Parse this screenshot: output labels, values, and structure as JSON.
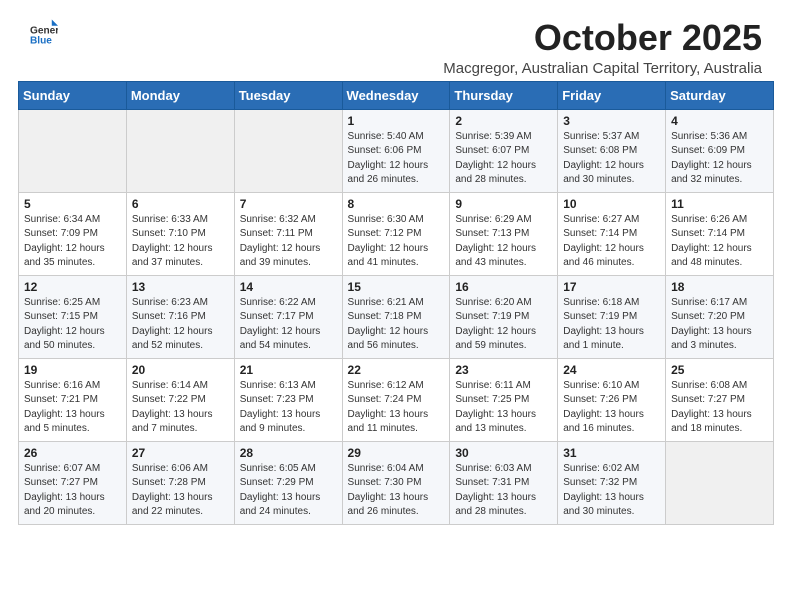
{
  "logo": {
    "text_general": "General",
    "text_blue": "Blue",
    "icon_label": "general-blue-logo"
  },
  "title": "October 2025",
  "subtitle": "Macgregor, Australian Capital Territory, Australia",
  "weekdays": [
    "Sunday",
    "Monday",
    "Tuesday",
    "Wednesday",
    "Thursday",
    "Friday",
    "Saturday"
  ],
  "weeks": [
    [
      {
        "day": "",
        "info": ""
      },
      {
        "day": "",
        "info": ""
      },
      {
        "day": "",
        "info": ""
      },
      {
        "day": "1",
        "info": "Sunrise: 5:40 AM\nSunset: 6:06 PM\nDaylight: 12 hours\nand 26 minutes."
      },
      {
        "day": "2",
        "info": "Sunrise: 5:39 AM\nSunset: 6:07 PM\nDaylight: 12 hours\nand 28 minutes."
      },
      {
        "day": "3",
        "info": "Sunrise: 5:37 AM\nSunset: 6:08 PM\nDaylight: 12 hours\nand 30 minutes."
      },
      {
        "day": "4",
        "info": "Sunrise: 5:36 AM\nSunset: 6:09 PM\nDaylight: 12 hours\nand 32 minutes."
      }
    ],
    [
      {
        "day": "5",
        "info": "Sunrise: 6:34 AM\nSunset: 7:09 PM\nDaylight: 12 hours\nand 35 minutes."
      },
      {
        "day": "6",
        "info": "Sunrise: 6:33 AM\nSunset: 7:10 PM\nDaylight: 12 hours\nand 37 minutes."
      },
      {
        "day": "7",
        "info": "Sunrise: 6:32 AM\nSunset: 7:11 PM\nDaylight: 12 hours\nand 39 minutes."
      },
      {
        "day": "8",
        "info": "Sunrise: 6:30 AM\nSunset: 7:12 PM\nDaylight: 12 hours\nand 41 minutes."
      },
      {
        "day": "9",
        "info": "Sunrise: 6:29 AM\nSunset: 7:13 PM\nDaylight: 12 hours\nand 43 minutes."
      },
      {
        "day": "10",
        "info": "Sunrise: 6:27 AM\nSunset: 7:14 PM\nDaylight: 12 hours\nand 46 minutes."
      },
      {
        "day": "11",
        "info": "Sunrise: 6:26 AM\nSunset: 7:14 PM\nDaylight: 12 hours\nand 48 minutes."
      }
    ],
    [
      {
        "day": "12",
        "info": "Sunrise: 6:25 AM\nSunset: 7:15 PM\nDaylight: 12 hours\nand 50 minutes."
      },
      {
        "day": "13",
        "info": "Sunrise: 6:23 AM\nSunset: 7:16 PM\nDaylight: 12 hours\nand 52 minutes."
      },
      {
        "day": "14",
        "info": "Sunrise: 6:22 AM\nSunset: 7:17 PM\nDaylight: 12 hours\nand 54 minutes."
      },
      {
        "day": "15",
        "info": "Sunrise: 6:21 AM\nSunset: 7:18 PM\nDaylight: 12 hours\nand 56 minutes."
      },
      {
        "day": "16",
        "info": "Sunrise: 6:20 AM\nSunset: 7:19 PM\nDaylight: 12 hours\nand 59 minutes."
      },
      {
        "day": "17",
        "info": "Sunrise: 6:18 AM\nSunset: 7:19 PM\nDaylight: 13 hours\nand 1 minute."
      },
      {
        "day": "18",
        "info": "Sunrise: 6:17 AM\nSunset: 7:20 PM\nDaylight: 13 hours\nand 3 minutes."
      }
    ],
    [
      {
        "day": "19",
        "info": "Sunrise: 6:16 AM\nSunset: 7:21 PM\nDaylight: 13 hours\nand 5 minutes."
      },
      {
        "day": "20",
        "info": "Sunrise: 6:14 AM\nSunset: 7:22 PM\nDaylight: 13 hours\nand 7 minutes."
      },
      {
        "day": "21",
        "info": "Sunrise: 6:13 AM\nSunset: 7:23 PM\nDaylight: 13 hours\nand 9 minutes."
      },
      {
        "day": "22",
        "info": "Sunrise: 6:12 AM\nSunset: 7:24 PM\nDaylight: 13 hours\nand 11 minutes."
      },
      {
        "day": "23",
        "info": "Sunrise: 6:11 AM\nSunset: 7:25 PM\nDaylight: 13 hours\nand 13 minutes."
      },
      {
        "day": "24",
        "info": "Sunrise: 6:10 AM\nSunset: 7:26 PM\nDaylight: 13 hours\nand 16 minutes."
      },
      {
        "day": "25",
        "info": "Sunrise: 6:08 AM\nSunset: 7:27 PM\nDaylight: 13 hours\nand 18 minutes."
      }
    ],
    [
      {
        "day": "26",
        "info": "Sunrise: 6:07 AM\nSunset: 7:27 PM\nDaylight: 13 hours\nand 20 minutes."
      },
      {
        "day": "27",
        "info": "Sunrise: 6:06 AM\nSunset: 7:28 PM\nDaylight: 13 hours\nand 22 minutes."
      },
      {
        "day": "28",
        "info": "Sunrise: 6:05 AM\nSunset: 7:29 PM\nDaylight: 13 hours\nand 24 minutes."
      },
      {
        "day": "29",
        "info": "Sunrise: 6:04 AM\nSunset: 7:30 PM\nDaylight: 13 hours\nand 26 minutes."
      },
      {
        "day": "30",
        "info": "Sunrise: 6:03 AM\nSunset: 7:31 PM\nDaylight: 13 hours\nand 28 minutes."
      },
      {
        "day": "31",
        "info": "Sunrise: 6:02 AM\nSunset: 7:32 PM\nDaylight: 13 hours\nand 30 minutes."
      },
      {
        "day": "",
        "info": ""
      }
    ]
  ]
}
